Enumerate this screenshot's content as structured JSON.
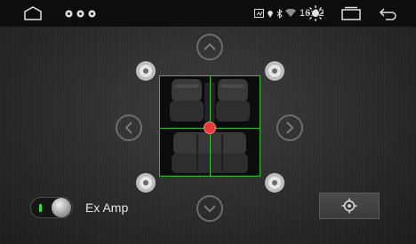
{
  "status_bar": {
    "time": "16:22",
    "icons": [
      "sim-icon",
      "location-icon",
      "bluetooth-icon",
      "wifi-icon",
      "brightness-icon"
    ]
  },
  "navigation": {
    "home": "home-icon",
    "recents": "recent-apps-icon",
    "back": "back-icon"
  },
  "balance_controls": {
    "arrows": [
      "up",
      "left",
      "right",
      "down"
    ]
  },
  "ex_amp": {
    "label": "Ex Amp",
    "enabled": true
  },
  "colors": {
    "grid": "#3bbf3b",
    "balance_point": "#e63a3a",
    "toggle_led": "#3fd73f"
  }
}
